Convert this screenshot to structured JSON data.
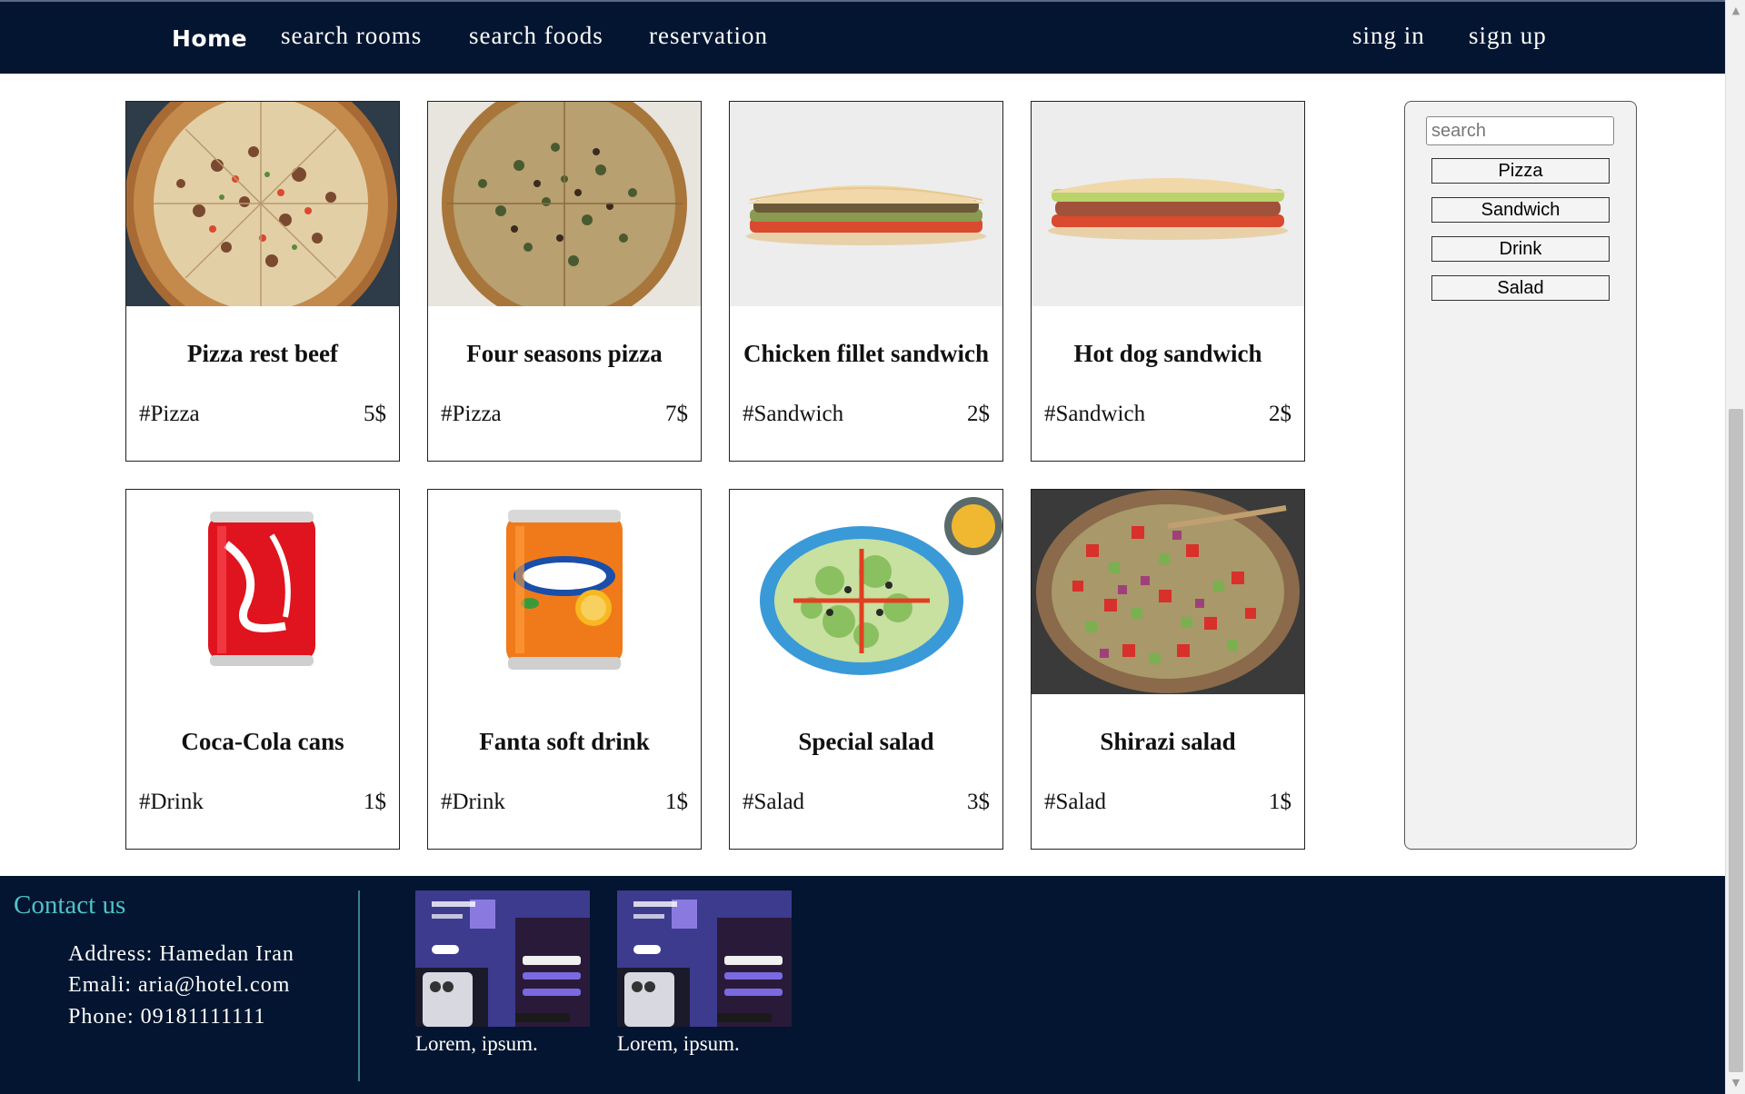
{
  "nav": {
    "home": "Home",
    "search_rooms": "search rooms",
    "search_foods": "search foods",
    "reservation": "reservation",
    "sign_in": "sing in",
    "sign_up": "sign up"
  },
  "foods": [
    {
      "title": "Pizza rest beef",
      "tag": "#Pizza",
      "price": "5$",
      "image": "pizza-beef"
    },
    {
      "title": "Four seasons pizza",
      "tag": "#Pizza",
      "price": "7$",
      "image": "pizza-four-seasons"
    },
    {
      "title": "Chicken fillet sandwich",
      "tag": "#Sandwich",
      "price": "2$",
      "image": "chicken-sandwich"
    },
    {
      "title": "Hot dog sandwich",
      "tag": "#Sandwich",
      "price": "2$",
      "image": "hotdog-sandwich"
    },
    {
      "title": "Coca-Cola cans",
      "tag": "#Drink",
      "price": "1$",
      "image": "coca-cola-can"
    },
    {
      "title": "Fanta soft drink",
      "tag": "#Drink",
      "price": "1$",
      "image": "fanta-can"
    },
    {
      "title": "Special salad",
      "tag": "#Salad",
      "price": "3$",
      "image": "special-salad"
    },
    {
      "title": "Shirazi salad",
      "tag": "#Salad",
      "price": "1$",
      "image": "shirazi-salad"
    }
  ],
  "sidebar": {
    "search_placeholder": "search",
    "categories": [
      "Pizza",
      "Sandwich",
      "Drink",
      "Salad"
    ]
  },
  "footer": {
    "contact_title": "Contact us",
    "address": "Address: Hamedan Iran",
    "email": "Emali: aria@hotel.com",
    "phone": "Phone: 09181111111",
    "promos": [
      {
        "caption": "Lorem, ipsum."
      },
      {
        "caption": "Lorem, ipsum."
      }
    ]
  },
  "colors": {
    "nav_bg": "#031530",
    "footer_bg": "#031530",
    "contact_title": "#4fc3c9",
    "sidebar_bg": "#f2f2f2"
  }
}
